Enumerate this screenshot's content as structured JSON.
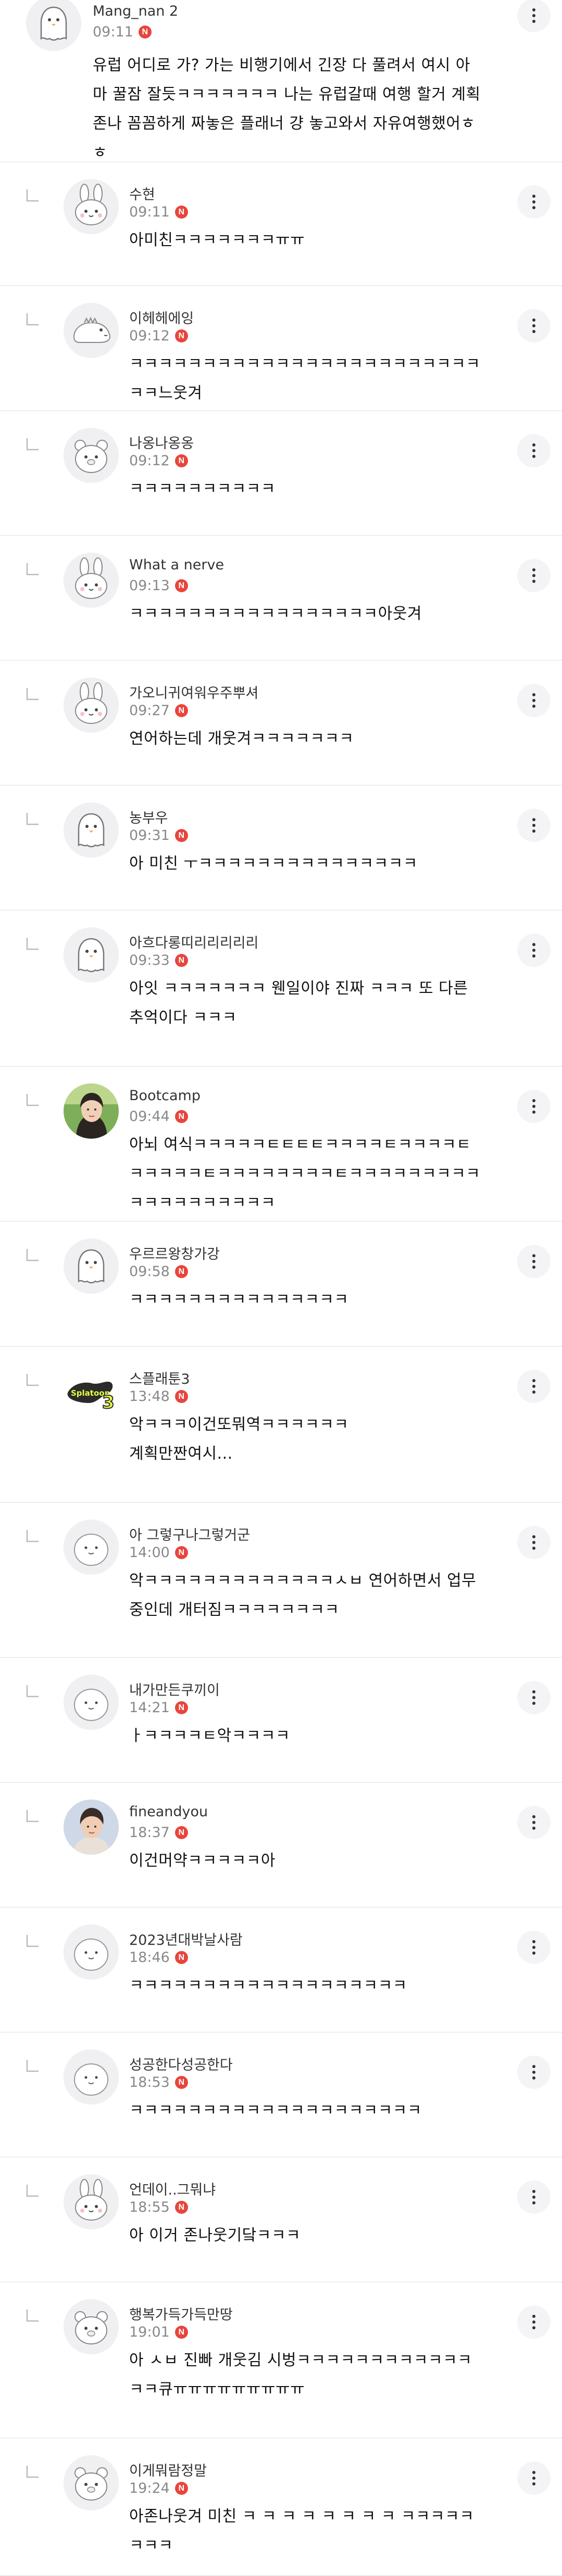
{
  "new_badge": "N",
  "comments": [
    {
      "name": "Mang_nan 2",
      "time": "09:11",
      "text": "유럽 어디로 가? 가는 비행기에서 긴장 다 풀려서 여시 아마 꿀잠 잘듯ㅋㅋㅋㅋㅋㅋㅋ 나는 유럽갈때 여행 할거 계획 존나 꼼꼼하게 짜놓은 플래너 걍 놓고와서 자유여행했어ㅎㅎ",
      "reply": false,
      "avatar": "penguin-ghost"
    },
    {
      "name": "수현",
      "time": "09:11",
      "text": "아미친ㅋㅋㅋㅋㅋㅋㅋㅠㅠ",
      "reply": true,
      "avatar": "bunny"
    },
    {
      "name": "이헤헤에잉",
      "time": "09:12",
      "text": "ㅋㅋㅋㅋㅋㅋㅋㅋㅋㅋㅋㅋㅋㅋㅋㅋㅋㅋㅋㅋㅋㅋㅋㅋㅋㅋ느웃겨",
      "reply": true,
      "avatar": "dino"
    },
    {
      "name": "나옹나옹옹",
      "time": "09:12",
      "text": "ㅋㅋㅋㅋㅋㅋㅋㅋㅋㅋ",
      "reply": true,
      "avatar": "bear"
    },
    {
      "name": "What a nerve",
      "time": "09:13",
      "text": "ㅋㅋㅋㅋㅋㅋㅋㅋㅋㅋㅋㅋㅋㅋㅋㅋㅋ아웃겨",
      "reply": true,
      "avatar": "bunny"
    },
    {
      "name": "가오니귀여워우주뿌셔",
      "time": "09:27",
      "text": "연어하는데 개웃겨ㅋㅋㅋㅋㅋㅋㅋ",
      "reply": true,
      "avatar": "bunny"
    },
    {
      "name": "농부우",
      "time": "09:31",
      "text": "아 미친 ㅜㅋㅋㅋㅋㅋㅋㅋㅋㅋㅋㅋㅋㅋㅋㅋ",
      "reply": true,
      "avatar": "penguin-ghost"
    },
    {
      "name": "아흐다롱띠리리리리리",
      "time": "09:33",
      "text": "아잇 ㅋㅋㅋㅋㅋㅋㅋ 웬일이야 진짜 ㅋㅋㅋ 또 다른 추억이다 ㅋㅋㅋ",
      "reply": true,
      "avatar": "penguin-ghost"
    },
    {
      "name": "Bootcamp",
      "time": "09:44",
      "text": "아뇌 여식ㅋㅋㅋㅋㅋㅌㅌㅌㅌㅋㅋㅋㅋㅌㅋㅋㅋㅋㅌㅋㅋㅋㅋㅋㅌㅋㅋㅋㅋㅋㅋㅋㅋㅌㅋㅋㅋㅋㅋㅋㅋㅋㅋㅋㅋㅋㅋㅋㅋㅋㅋㅋㅋ",
      "reply": true,
      "avatar": "photo-girl"
    },
    {
      "name": "우르르왕창가강",
      "time": "09:58",
      "text": "ㅋㅋㅋㅋㅋㅋㅋㅋㅋㅋㅋㅋㅋㅋㅋ",
      "reply": true,
      "avatar": "penguin-ghost"
    },
    {
      "name": "스플래툰3",
      "time": "13:48",
      "text": "악ㅋㅋㅋ이건또뭐역ㅋㅋㅋㅋㅋㅋ\n계획만짠여시...",
      "reply": true,
      "avatar": "splatoon-logo"
    },
    {
      "name": "아 그렇구나그렇거군",
      "time": "14:00",
      "text": "악ㅋㅋㅋㅋㅋㅋㅋㅋㅋㅋㅋㅋㅋㅅㅂ 연어하면서 업무 중인데 개터짐ㅋㅋㅋㅋㅋㅋㅋㅋ",
      "reply": true,
      "avatar": "blob"
    },
    {
      "name": "내가만든쿠끼이",
      "time": "14:21",
      "text": "ㅏㅋㅋㅋㅋㅌ악ㅋㅋㅋㅋ",
      "reply": true,
      "avatar": "blob"
    },
    {
      "name": "fineandyou",
      "time": "18:37",
      "text": "이건머약ㅋㅋㅋㅋㅋ아",
      "reply": true,
      "avatar": "photo-guy"
    },
    {
      "name": "2023년대박날사람",
      "time": "18:46",
      "text": "ㅋㅋㅋㅋㅋㅋㅋㅋㅋㅋㅋㅋㅋㅋㅋㅋㅋㅋㅋ",
      "reply": true,
      "avatar": "blob"
    },
    {
      "name": "성공한다성공한다",
      "time": "18:53",
      "text": "ㅋㅋㅋㅋㅋㅋㅋㅋㅋㅋㅋㅋㅋㅋㅋㅋㅋㅋㅋㅋ",
      "reply": true,
      "avatar": "blob"
    },
    {
      "name": "언데이..그뭐냐",
      "time": "18:55",
      "text": "아 이거 존나웃기닼ㅋㅋㅋ",
      "reply": true,
      "avatar": "bunny"
    },
    {
      "name": "행복가득가득만땅",
      "time": "19:01",
      "text": "아 ㅅㅂ 진빠 개웃김 시벙ㅋㅋㅋㅋㅋㅋㅋㅋㅋㅋㅋㅋㅋㅋ큐ㅠㅠㅠㅠㅠㅠㅠㅠㅠ",
      "reply": true,
      "avatar": "bear"
    },
    {
      "name": "이게뭐람정말",
      "time": "19:24",
      "text": "아존나웃겨 미친 ㅋ ㅋ ㅋ ㅋ ㅋ ㅋ ㅋ ㅋ ㅋㅋㅋㅋㅋㅋㅋㅋ",
      "reply": true,
      "avatar": "bear"
    }
  ]
}
